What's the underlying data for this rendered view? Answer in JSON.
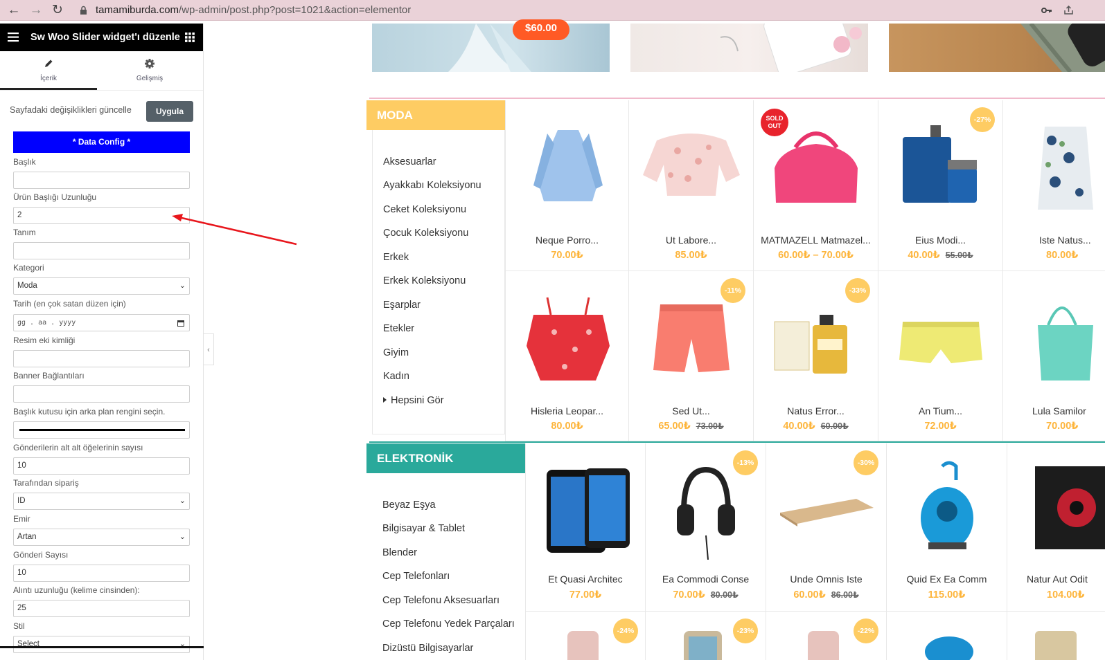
{
  "browser": {
    "url_domain": "tamamiburda.com",
    "url_path": "/wp-admin/post.php?post=1021&action=elementor"
  },
  "sidebar": {
    "title": "Sw Woo Slider widget'ı düzenle",
    "tabs": [
      {
        "label": "İçerik",
        "icon": "pencil-icon"
      },
      {
        "label": "Gelişmiş",
        "icon": "gear-icon"
      }
    ],
    "update_text": "Sayfadaki değişiklikleri güncelle",
    "apply_label": "Uygula",
    "data_config_label": "* Data Config *",
    "fields": [
      {
        "label": "Başlık",
        "value": ""
      },
      {
        "label": "Ürün Başlığı Uzunluğu",
        "value": "2"
      },
      {
        "label": "Tanım",
        "value": ""
      },
      {
        "label": "Kategori",
        "value": "Moda"
      },
      {
        "label": "Tarih (en çok satan düzen için)",
        "value": "gg . aa . yyyy"
      },
      {
        "label": "Resim eki kimliği",
        "value": ""
      },
      {
        "label": "Banner Bağlantıları",
        "value": ""
      },
      {
        "label": "Başlık kutusu için arka plan rengini seçin.",
        "value": "#000000"
      },
      {
        "label": "Gönderilerin alt alt öğelerinin sayısı",
        "value": "10"
      },
      {
        "label": "Tarafından sipariş",
        "value": "ID"
      },
      {
        "label": "Emir",
        "value": "Artan"
      },
      {
        "label": "Gönderi Sayısı",
        "value": "10"
      },
      {
        "label": "Alıntı uzunluğu (kelime cinsinden):",
        "value": "25"
      },
      {
        "label": "Stil",
        "value": "Select"
      }
    ]
  },
  "banner": {
    "price": "$60.00"
  },
  "moda": {
    "title": "MODA",
    "color": "#fecc63",
    "categories": [
      "Aksesuarlar",
      "Ayakkabı Koleksiyonu",
      "Ceket Koleksiyonu",
      "Çocuk Koleksiyonu",
      "Erkek",
      "Erkek Koleksiyonu",
      "Eşarplar",
      "Etekler",
      "Giyim",
      "Kadın",
      "Hepsini Gör"
    ],
    "products": [
      {
        "name": "Neque Porro...",
        "price": "70.00₺",
        "old": "",
        "badge": ""
      },
      {
        "name": "Ut Labore...",
        "price": "85.00₺",
        "old": "",
        "badge": ""
      },
      {
        "name": "MATMAZELL Matmazel...",
        "price": "60.00₺ – 70.00₺",
        "old": "",
        "badge": "SOLD OUT"
      },
      {
        "name": "Eius Modi...",
        "price": "40.00₺",
        "old": "55.00₺",
        "badge": "-27%"
      },
      {
        "name": "Iste Natus...",
        "price": "80.00₺",
        "old": "",
        "badge": ""
      },
      {
        "name": "Hisleria Leopar...",
        "price": "80.00₺",
        "old": "",
        "badge": ""
      },
      {
        "name": "Sed Ut...",
        "price": "65.00₺",
        "old": "73.00₺",
        "badge": "-11%"
      },
      {
        "name": "Natus Error...",
        "price": "40.00₺",
        "old": "60.00₺",
        "badge": "-33%"
      },
      {
        "name": "An Tium...",
        "price": "72.00₺",
        "old": "",
        "badge": ""
      },
      {
        "name": "Lula Samilor",
        "price": "70.00₺",
        "old": "",
        "badge": ""
      }
    ]
  },
  "elektronik": {
    "title": "ELEKTRONİK",
    "color": "#2aa99b",
    "categories": [
      "Beyaz Eşya",
      "Bilgisayar & Tablet",
      "Blender",
      "Cep Telefonları",
      "Cep Telefonu Aksesuarları",
      "Cep Telefonu Yedek Parçaları",
      "Dizüstü Bilgisayarlar"
    ],
    "products": [
      {
        "name": "Et Quasi Architec",
        "price": "77.00₺",
        "old": "",
        "badge": ""
      },
      {
        "name": "Ea Commodi Conse",
        "price": "70.00₺",
        "old": "80.00₺",
        "badge": "-13%"
      },
      {
        "name": "Unde Omnis Iste",
        "price": "60.00₺",
        "old": "86.00₺",
        "badge": "-30%"
      },
      {
        "name": "Quid Ex Ea Comm",
        "price": "115.00₺",
        "old": "",
        "badge": ""
      },
      {
        "name": "Natur Aut Odit",
        "price": "104.00₺",
        "old": "",
        "badge": ""
      }
    ],
    "next_badges": [
      "-24%",
      "-23%",
      "-22%"
    ]
  }
}
